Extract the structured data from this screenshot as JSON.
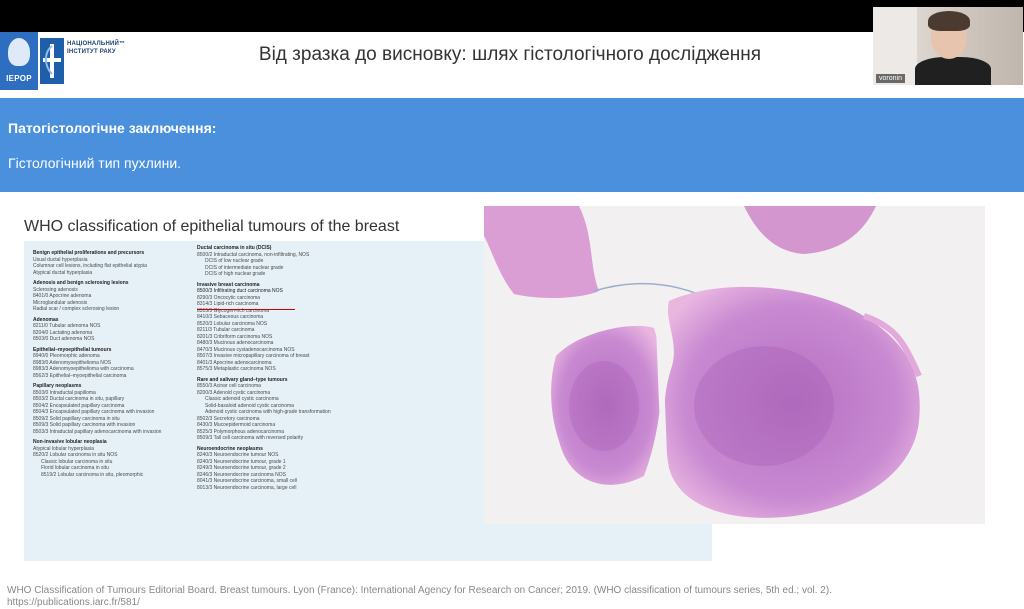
{
  "header": {
    "iepor_logo_text": "ІЕРОР",
    "nir_logo_line1": "НАЦІОНАЛЬНИЙ™",
    "nir_logo_line2": "ІНСТИТУТ РАКУ",
    "title": "Від зразка до висновку: шлях гістологічного дослідження"
  },
  "video": {
    "participant_name": "voronin"
  },
  "banner": {
    "heading": "Патогістологічне заключення:",
    "text": "Гістологічний тип пухлини."
  },
  "who": {
    "title": "WHO classification of epithelial tumours of the breast",
    "col1": [
      {
        "t": "Benign epithelial proliferations and precursors",
        "s": true
      },
      {
        "t": "Usual ductal hyperplasia"
      },
      {
        "t": "Columnar cell lesions, including flat epithelial atypia"
      },
      {
        "t": "Atypical ductal hyperplasia"
      },
      {
        "t": "Adenosis and benign sclerosing lesions",
        "s": true
      },
      {
        "t": "Sclerosing adenosis"
      },
      {
        "t": "8401/0 Apocrine adenoma"
      },
      {
        "t": "Microglandular adenosis"
      },
      {
        "t": "Radial scar / complex sclerosing lesion"
      },
      {
        "t": "Adenomas",
        "s": true
      },
      {
        "t": "8211/0 Tubular adenoma NOS"
      },
      {
        "t": "8204/0 Lactating adenoma"
      },
      {
        "t": "8503/0 Duct adenoma NOS"
      },
      {
        "t": "Epithelial–myoepithelial tumours",
        "s": true
      },
      {
        "t": "8940/0 Pleomorphic adenoma"
      },
      {
        "t": "8983/0 Adenomyoepithelioma NOS"
      },
      {
        "t": "8983/3 Adenomyoepithelioma with carcinoma"
      },
      {
        "t": "8562/3 Epithelial–myoepithelial carcinoma"
      },
      {
        "t": "Papillary neoplasms",
        "s": true
      },
      {
        "t": "8503/0 Intraductal papilloma"
      },
      {
        "t": "8503/2 Ductal carcinoma in situ, papillary"
      },
      {
        "t": "8504/2 Encapsulated papillary carcinoma"
      },
      {
        "t": "8504/3 Encapsulated papillary carcinoma with invasion"
      },
      {
        "t": "8509/2 Solid papillary carcinoma in situ"
      },
      {
        "t": "8509/3 Solid papillary carcinoma with invasion"
      },
      {
        "t": "8503/3 Intraductal papillary adenocarcinoma with invasion"
      },
      {
        "t": "Non-invasive lobular neoplasia",
        "s": true
      },
      {
        "t": "Atypical lobular hyperplasia"
      },
      {
        "t": "8520/2 Lobular carcinoma in situ NOS"
      },
      {
        "t": "Classic lobular carcinoma in situ",
        "i": true
      },
      {
        "t": "Florid lobular carcinoma in situ",
        "i": true
      },
      {
        "t": "8519/2 Lobular carcinoma in situ, pleomorphic",
        "i": true
      }
    ],
    "col2": [
      {
        "t": "Ductal carcinoma in situ (DCIS)",
        "s": true
      },
      {
        "t": "8500/2 Intraductal carcinoma, non-infiltrating, NOS"
      },
      {
        "t": "DCIS of low nuclear grade",
        "i": true
      },
      {
        "t": "DCIS of intermediate nuclear grade",
        "i": true
      },
      {
        "t": "DCIS of high nuclear grade",
        "i": true
      },
      {
        "t": "Invasive breast carcinoma",
        "s": true
      },
      {
        "t": "8500/3 Infiltrating duct carcinoma NOS",
        "h": true
      },
      {
        "t": "8290/3 Oncocytic carcinoma"
      },
      {
        "t": "8314/3 Lipid-rich carcinoma"
      },
      {
        "t": "8315/3 Glycogen-rich carcinoma"
      },
      {
        "t": "8410/3 Sebaceous carcinoma"
      },
      {
        "t": "8520/3 Lobular carcinoma NOS"
      },
      {
        "t": "8211/3 Tubular carcinoma"
      },
      {
        "t": "8201/3 Cribriform carcinoma NOS"
      },
      {
        "t": "8480/3 Mucinous adenocarcinoma"
      },
      {
        "t": "8470/3 Mucinous cystadenocarcinoma NOS"
      },
      {
        "t": "8507/3 Invasive micropapillary carcinoma of breast"
      },
      {
        "t": "8401/3 Apocrine adenocarcinoma"
      },
      {
        "t": "8575/3 Metaplastic carcinoma NOS"
      },
      {
        "t": "Rare and salivary gland–type tumours",
        "s": true
      },
      {
        "t": "8550/3 Acinar cell carcinoma"
      },
      {
        "t": "8200/3 Adenoid cystic carcinoma"
      },
      {
        "t": "Classic adenoid cystic carcinoma",
        "i": true
      },
      {
        "t": "Solid-basaloid adenoid cystic carcinoma",
        "i": true
      },
      {
        "t": "Adenoid cystic carcinoma with high-grade transformation",
        "i": true
      },
      {
        "t": "8502/3 Secretory carcinoma"
      },
      {
        "t": "8430/3 Mucoepidermoid carcinoma"
      },
      {
        "t": "8525/3 Polymorphous adenocarcinoma"
      },
      {
        "t": "8509/3 Tall cell carcinoma with reversed polarity"
      },
      {
        "t": "Neuroendocrine neoplasms",
        "s": true
      },
      {
        "t": "8240/3 Neuroendocrine tumour NOS"
      },
      {
        "t": "8240/3 Neuroendocrine tumour, grade 1"
      },
      {
        "t": "8249/3 Neuroendocrine tumour, grade 2"
      },
      {
        "t": "8246/3 Neuroendocrine carcinoma NOS"
      },
      {
        "t": "8041/3 Neuroendocrine carcinoma, small cell"
      },
      {
        "t": "8013/3 Neuroendocrine carcinoma, large cell"
      }
    ]
  },
  "citation": {
    "line1": "WHO Classification of Tumours Editorial Board. Breast tumours. Lyon (France): International Agency for Research on Cancer; 2019. (WHO classification of tumours series, 5th ed.; vol. 2).",
    "line2": "https://publications.iarc.fr/581/"
  },
  "colors": {
    "banner": "#4a90dd",
    "highlight_underline": "#d20000",
    "panel": "#e6f1f7"
  }
}
